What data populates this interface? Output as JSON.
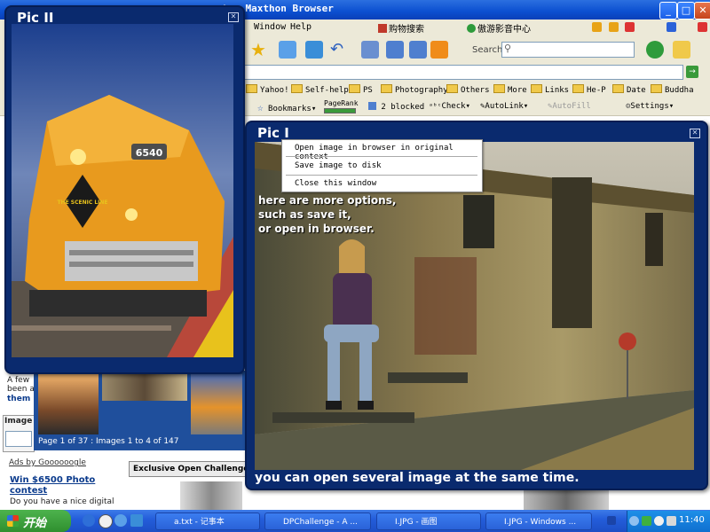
{
  "browser": {
    "title": "t - Maxthon Browser",
    "menu": [
      "Window",
      "Help"
    ],
    "search_label": "Search",
    "links": [
      "Yahoo!",
      "Self-help",
      "PS",
      "Photography",
      "Others",
      "More",
      "Links",
      "He-P",
      "Date",
      "Buddha"
    ],
    "bookmark_bar": {
      "bookmarks": "Bookmarks",
      "pagerank": "PageRank",
      "blocked": "2 blocked",
      "check": "Check",
      "autolink": "AutoLink",
      "autofill": "AutoFill",
      "settings": "Settings"
    },
    "toolbar_text": {
      "shopping": "购物搜索",
      "game_center": "傲游影音中心"
    }
  },
  "webpage": {
    "snippet_1": "A few",
    "snippet_2": "been a",
    "snippet_3": "them",
    "image_label": "Image",
    "gallery_caption": "Page 1 of 37 : Images 1 to 4 of 147",
    "ads_header": "Ads by Goooooogle",
    "ads_link": "Win $6500 Photo contest",
    "ads_text": "Do you have a nice digital",
    "challenge_tab": "Exclusive Open Challenge W"
  },
  "pic2": {
    "title": "Pic II"
  },
  "pic1": {
    "title": "Pic I",
    "overlay_lines": [
      "here are more options,",
      "such as save it,",
      "or open in browser."
    ],
    "bottom_caption": "you can open several image at the same time."
  },
  "context_menu": {
    "items": [
      "Open image in browser in original context",
      "Save image to disk",
      "Close this window"
    ]
  },
  "taskbar": {
    "start": "开始",
    "tasks": [
      "a.txt - 记事本",
      "DPChallenge - A ...",
      "I.JPG - 画图",
      "I.JPG - Windows ..."
    ],
    "clock": "11:40"
  },
  "colors": {
    "popup_bg": "#0a2a6e",
    "titlebar": "#0b4fd0",
    "taskbar": "#245edb"
  }
}
